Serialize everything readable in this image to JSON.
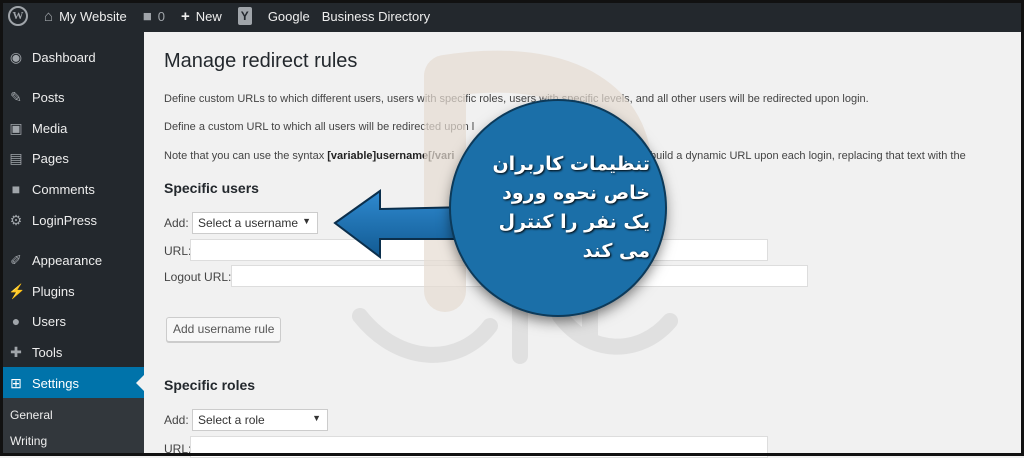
{
  "adminbar": {
    "site_name": "My Website",
    "comments_count": "0",
    "new_label": "New",
    "yoast_label": "Y",
    "google_label": "Google",
    "directory_label": "Business Directory",
    "wp_logo_letter": "W"
  },
  "sidebar": {
    "items": [
      {
        "label": "Dashboard",
        "icon": "dashboard-icon"
      },
      {
        "label": "Posts",
        "icon": "pin-icon"
      },
      {
        "label": "Media",
        "icon": "media-icon"
      },
      {
        "label": "Pages",
        "icon": "pages-icon"
      },
      {
        "label": "Comments",
        "icon": "comment-icon"
      },
      {
        "label": "LoginPress",
        "icon": "gear-icon"
      },
      {
        "label": "Appearance",
        "icon": "brush-icon"
      },
      {
        "label": "Plugins",
        "icon": "plugin-icon"
      },
      {
        "label": "Users",
        "icon": "user-icon"
      },
      {
        "label": "Tools",
        "icon": "wrench-icon"
      },
      {
        "label": "Settings",
        "icon": "settings-icon",
        "active": true
      }
    ],
    "submenu": [
      "General",
      "Writing"
    ]
  },
  "main": {
    "title": "Manage redirect rules",
    "desc1": "Define custom URLs to which different users, users with specific roles, users with specific levels, and all other users will be redirected upon login.",
    "desc2": "Define a custom URL to which all users will be redirected upon l",
    "desc3_pre": "Note that you can use the syntax ",
    "desc3_bold": "[variable]username[/vari",
    "desc3_post": "m will build a dynamic URL upon each login, replacing that text with the",
    "specific_users": {
      "title": "Specific users",
      "add_label": "Add:",
      "select_value": "Select a username",
      "url_label": "URL:",
      "logout_label": "Logout URL:",
      "button": "Add username rule"
    },
    "specific_roles": {
      "title": "Specific roles",
      "add_label": "Add:",
      "select_value": "Select a role",
      "url_label": "URL:"
    }
  },
  "callout": {
    "text": "تنظیمات کاربران خاص نحوه ورود یک نفر را کنترل می کند"
  },
  "colors": {
    "adminbar": "#23282d",
    "active": "#0073aa",
    "callout": "#1b6fa8"
  }
}
